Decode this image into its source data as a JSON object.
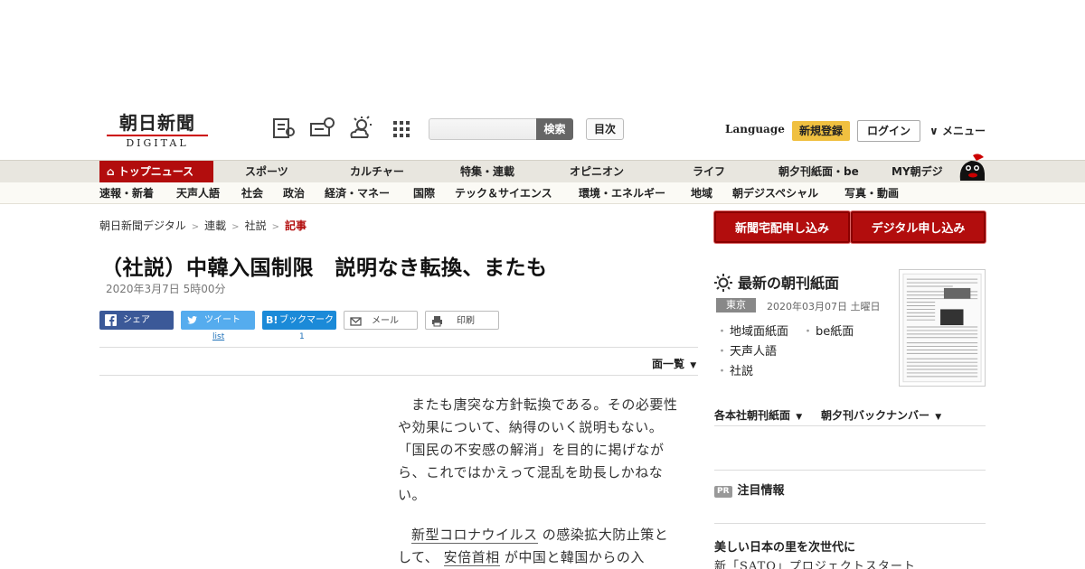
{
  "header": {
    "logo_jp": "朝日新聞",
    "logo_en": "DIGITAL",
    "search_button": "検索",
    "toc_button": "目次",
    "language": "Language",
    "register_button": "新規登録",
    "login_button": "ログイン",
    "menu_button": "メニュー"
  },
  "gnav": [
    "トップニュース",
    "スポーツ",
    "カルチャー",
    "特集・連載",
    "オピニオン",
    "ライフ",
    "朝夕刊紙面・be",
    "MY朝デジ"
  ],
  "snav": [
    "速報・新着",
    "天声人語",
    "社会",
    "政治",
    "経済・マネー",
    "国際",
    "テック＆サイエンス",
    "環境・エネルギー",
    "地域",
    "朝デジスペシャル",
    "写真・動画"
  ],
  "breadcrumb": [
    "朝日新聞デジタル",
    "連載",
    "社説",
    "記事"
  ],
  "article": {
    "title": "（社説）中韓入国制限　説明なき転換、またも",
    "date": "2020年3月7日 5時00分",
    "p1": "またも唐突な方針転換である。その必要性や効果について、納得のいく説明もない。「国民の不安感の解消」を目的に掲げながら、これではかえって混乱を助長しかねない。",
    "p2_a": "新型コロナウイルス",
    "p2_b": " の感染拡大防止策として、 ",
    "p2_c": "安倍首相",
    "p2_d": " が中国と韓国からの入"
  },
  "share": {
    "facebook": "シェア",
    "twitter": "ツイート",
    "twitter_count": "list",
    "hatena": "ブックマーク",
    "hatena_count": "1",
    "mail": "メール",
    "print": "印刷"
  },
  "list_link": "面一覧",
  "sidebar": {
    "cta_paper": "新聞宅配申し込み",
    "cta_digital": "デジタル申し込み",
    "latest_title": "最新の朝刊紙面",
    "region": "東京",
    "paper_date": "2020年03月07日 土曜日",
    "links": [
      "地域面紙面",
      "be紙面",
      "天声人語",
      "社説"
    ],
    "backnum_1": "各本社朝刊紙面",
    "backnum_2": "朝夕刊バックナンバー",
    "pr_tag": "PR",
    "pr_label": "注目情報",
    "pr_title": "美しい日本の里を次世代に",
    "pr_sub": "新「SATO」プロジェクトスタート"
  },
  "colors": {
    "brand_red": "#b20d0d",
    "facebook": "#3b5998",
    "twitter": "#55acee",
    "hatena": "#1b8ad8",
    "register_yellow": "#f0c040"
  }
}
